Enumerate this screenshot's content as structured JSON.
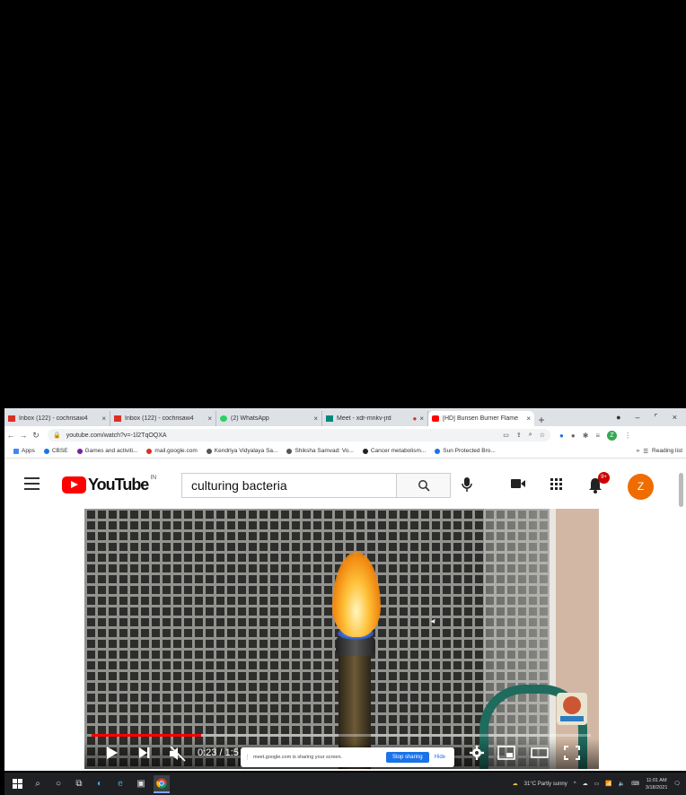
{
  "browser": {
    "tabs": [
      {
        "label": "Inbox (122) - cochrisaw4",
        "favicon_color": "#d93025"
      },
      {
        "label": "Inbox (122) - cochrisaw4",
        "favicon_color": "#d93025"
      },
      {
        "label": "(2) WhatsApp",
        "favicon_color": "#25d366"
      },
      {
        "label": "Meet - xdr-mnkv-jrd",
        "favicon_color": "#00897b"
      },
      {
        "label": "[HD] Bunsen Burner Flame",
        "favicon_color": "#ff0000",
        "active": true
      }
    ],
    "new_tab": "+",
    "url": "youtube.com/watch?v=-1l2TqOQXA",
    "bookmarks": [
      {
        "label": "Apps",
        "color": "#4285f4"
      },
      {
        "label": "CBSE",
        "color": "#1a73e8"
      },
      {
        "label": "Games and activiti...",
        "color": "#7b1fa2"
      },
      {
        "label": "mail.google.com",
        "color": "#d93025"
      },
      {
        "label": "Kendriya Vidyalaya Sa...",
        "color": "#555555"
      },
      {
        "label": "Shiksha Samvad: Vo...",
        "color": "#555555"
      },
      {
        "label": "Cancer metabolism...",
        "color": "#222222"
      },
      {
        "label": "Sun Protected Bro...",
        "color": "#1a73e8"
      }
    ],
    "reading_list": "Reading list",
    "profile_initial": "Z"
  },
  "youtube": {
    "logo_text": "YouTube",
    "country_code": "IN",
    "search_value": "culturing bacteria",
    "notification_count": "9+",
    "avatar_initial": "Z",
    "avatar_color": "#ef6c00"
  },
  "player": {
    "time": "0:23 / 1:5",
    "progress": 0.22
  },
  "screen_share": {
    "message": "meet.google.com is sharing your screen.",
    "stop_label": "Stop sharing",
    "hide_label": "Hide"
  },
  "taskbar": {
    "weather": "31°C  Partly sunny",
    "time": "11:01 AM",
    "date": "3/18/2021"
  }
}
